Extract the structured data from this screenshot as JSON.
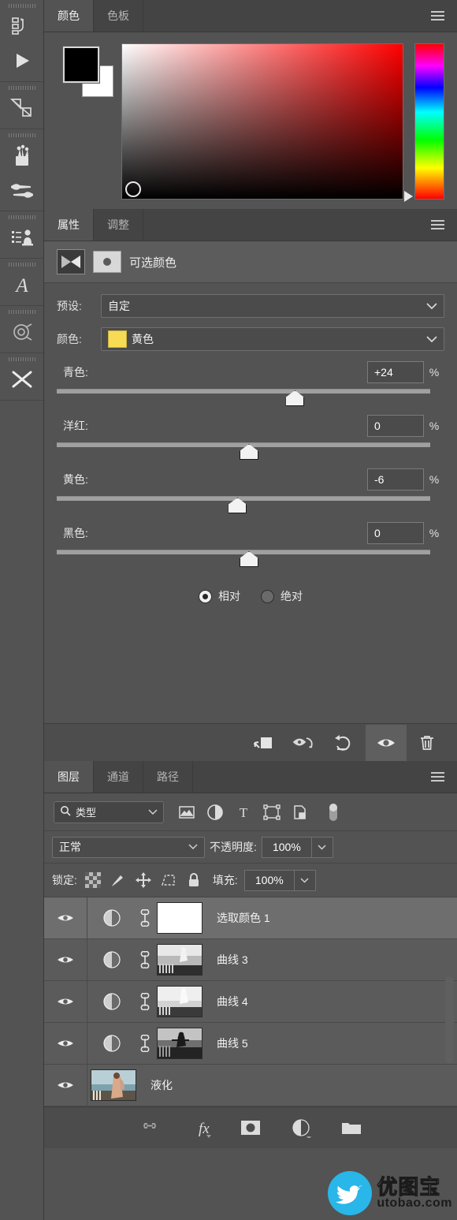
{
  "color_panel": {
    "tabs": [
      {
        "label": "颜色",
        "active": true
      },
      {
        "label": "色板",
        "active": false
      }
    ],
    "menu_icon": "hamburger-menu-icon",
    "foreground_color": "#000000",
    "background_color": "#ffffff",
    "field_icon": "color-field",
    "hue_icon": "hue-strip"
  },
  "properties_panel": {
    "tabs": [
      {
        "label": "属性",
        "active": true
      },
      {
        "label": "调整",
        "active": false
      }
    ],
    "menu_icon": "hamburger-menu-icon",
    "adjustment_title": "可选颜色",
    "preset": {
      "label": "预设:",
      "value": "自定"
    },
    "color": {
      "label": "颜色:",
      "value": "黄色",
      "swatch": "#f7db54"
    },
    "sliders": [
      {
        "label": "青色:",
        "value": "+24",
        "unit": "%",
        "percent": 62
      },
      {
        "label": "洋红:",
        "value": "0",
        "unit": "%",
        "percent": 50
      },
      {
        "label": "黄色:",
        "value": "-6",
        "unit": "%",
        "percent": 47
      },
      {
        "label": "黑色:",
        "value": "0",
        "unit": "%",
        "percent": 50
      }
    ],
    "method": {
      "relative": {
        "label": "相对",
        "selected": true
      },
      "absolute": {
        "label": "绝对",
        "selected": false
      }
    },
    "footer_buttons": [
      {
        "name": "clip-to-layer-icon",
        "active": false
      },
      {
        "name": "toggle-layer-visibility-icon",
        "active": false
      },
      {
        "name": "reset-adjustment-icon",
        "active": false
      },
      {
        "name": "preview-eye-icon",
        "active": true
      },
      {
        "name": "delete-adjustment-icon",
        "active": false
      }
    ]
  },
  "layers_panel": {
    "tabs": [
      {
        "label": "图层",
        "active": true
      },
      {
        "label": "通道",
        "active": false
      },
      {
        "label": "路径",
        "active": false
      }
    ],
    "menu_icon": "hamburger-menu-icon",
    "filter": {
      "kind": "类型",
      "icons": [
        "pixel-layer-filter-icon",
        "adjustment-layer-filter-icon",
        "text-layer-filter-icon",
        "shape-layer-filter-icon",
        "smart-object-filter-icon"
      ],
      "toggle": "filter-power-toggle"
    },
    "blend_mode": "正常",
    "opacity": {
      "label": "不透明度:",
      "value": "100%"
    },
    "lock": {
      "label": "锁定:",
      "icons": [
        "lock-transparent-pixels-icon",
        "lock-image-pixels-icon",
        "lock-position-icon",
        "lock-artboard-icon",
        "lock-all-icon"
      ]
    },
    "fill": {
      "label": "填充:",
      "value": "100%"
    },
    "layers": [
      {
        "name": "选取颜色 1",
        "visible": true,
        "type": "adjustment",
        "selected": true,
        "thumb": "white-mask",
        "linked": true
      },
      {
        "name": "曲线 3",
        "visible": true,
        "type": "adjustment",
        "selected": false,
        "thumb": "bw-photo",
        "linked": true
      },
      {
        "name": "曲线 4",
        "visible": true,
        "type": "adjustment",
        "selected": false,
        "thumb": "bw-photo",
        "linked": true
      },
      {
        "name": "曲线 5",
        "visible": true,
        "type": "adjustment",
        "selected": false,
        "thumb": "bw-photo",
        "linked": true
      },
      {
        "name": "液化",
        "visible": true,
        "type": "pixel",
        "selected": false,
        "thumb": "color-photo",
        "linked": false
      }
    ],
    "footer_buttons": [
      {
        "name": "link-layers-icon"
      },
      {
        "name": "layer-style-fx-icon"
      },
      {
        "name": "add-layer-mask-icon"
      },
      {
        "name": "new-adjustment-layer-icon"
      },
      {
        "name": "new-group-folder-icon"
      }
    ]
  },
  "tool_dock": {
    "items": [
      {
        "name": "history-actions-icon"
      },
      {
        "name": "play-action-icon"
      },
      {
        "name": "adjustments-3d-icon"
      },
      {
        "name": "brush-presets-icon"
      },
      {
        "name": "brush-settings-icon"
      },
      {
        "name": "clone-source-icon"
      },
      {
        "name": "character-panel-icon"
      },
      {
        "name": "paths-panel-icon"
      },
      {
        "name": "tool-presets-icon"
      }
    ]
  },
  "watermark": {
    "cn": "优图宝",
    "en": "utobao.com",
    "brand_color": "#29b6e8"
  }
}
